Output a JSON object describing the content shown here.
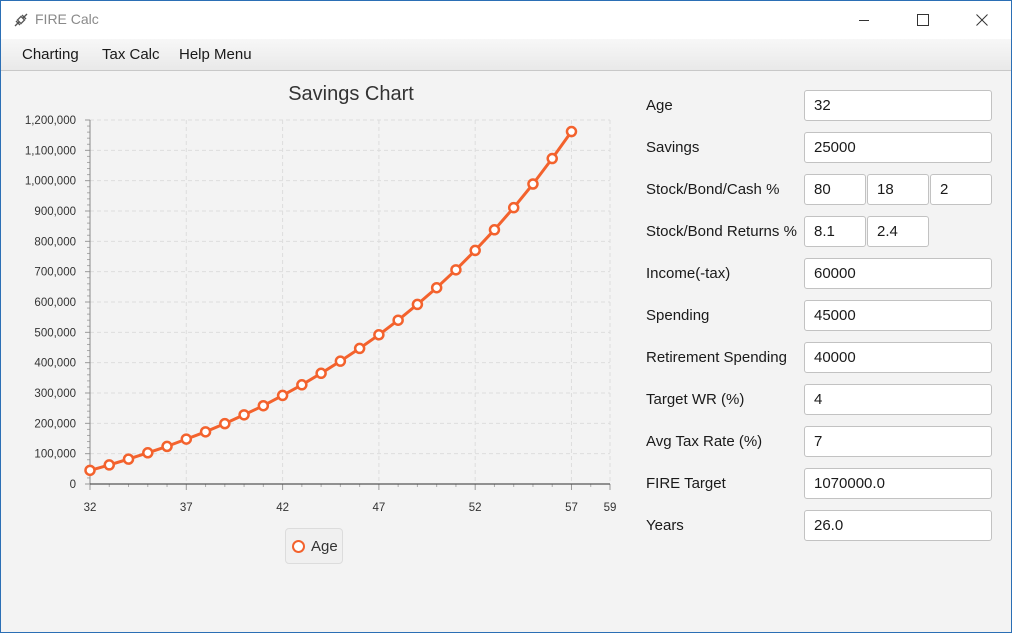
{
  "window": {
    "title": "FIRE Calc",
    "app_icon": "satellite-icon",
    "controls": [
      "minimize-icon",
      "maximize-icon",
      "close-icon"
    ]
  },
  "menubar": {
    "items": [
      {
        "label": "Charting"
      },
      {
        "label": "Tax Calc"
      },
      {
        "label": "Help Menu"
      }
    ]
  },
  "colors": {
    "series": "#f3622d",
    "window_border": "#2b6fb5",
    "grid": "#dddddd"
  },
  "form": {
    "age": {
      "label": "Age",
      "value": "32"
    },
    "savings": {
      "label": "Savings",
      "value": "25000"
    },
    "allocation": {
      "label": "Stock/Bond/Cash %",
      "stock": "80",
      "bond": "18",
      "cash": "2"
    },
    "returns": {
      "label": "Stock/Bond Returns %",
      "stock": "8.1",
      "bond": "2.4"
    },
    "income": {
      "label": "Income(-tax)",
      "value": "60000"
    },
    "spending": {
      "label": "Spending",
      "value": "45000"
    },
    "retirement_spending": {
      "label": "Retirement Spending",
      "value": "40000"
    },
    "target_wr": {
      "label": "Target WR (%)",
      "value": "4"
    },
    "avg_tax_rate": {
      "label": "Avg Tax Rate (%)",
      "value": "7"
    },
    "fire_target": {
      "label": "FIRE Target",
      "value": "1070000.0"
    },
    "years": {
      "label": "Years",
      "value": "26.0"
    }
  },
  "chart_data": {
    "type": "line",
    "title": "Savings Chart",
    "xlabel": "",
    "ylabel": "",
    "xlim": [
      32,
      59
    ],
    "ylim": [
      0,
      1200000
    ],
    "x_ticks": [
      32,
      37,
      42,
      47,
      52,
      57,
      59
    ],
    "y_ticks": [
      0,
      100000,
      200000,
      300000,
      400000,
      500000,
      600000,
      700000,
      800000,
      900000,
      1000000,
      1100000,
      1200000
    ],
    "y_tick_labels": [
      "0",
      "100,000",
      "200,000",
      "300,000",
      "400,000",
      "500,000",
      "600,000",
      "700,000",
      "800,000",
      "900,000",
      "1,000,000",
      "1,100,000",
      "1,200,000"
    ],
    "grid": true,
    "legend_position": "bottom",
    "series": [
      {
        "name": "Age",
        "x": [
          32,
          33,
          34,
          35,
          36,
          37,
          38,
          39,
          40,
          41,
          42,
          43,
          44,
          45,
          46,
          47,
          48,
          49,
          50,
          51,
          52,
          53,
          54,
          55,
          56,
          57
        ],
        "y": [
          45000,
          63000,
          82000,
          103000,
          124000,
          148000,
          172000,
          199000,
          228000,
          258000,
          292000,
          327000,
          365000,
          405000,
          447000,
          492000,
          540000,
          592000,
          647000,
          706000,
          770000,
          838000,
          911000,
          989000,
          1073000,
          1162000
        ]
      }
    ]
  }
}
